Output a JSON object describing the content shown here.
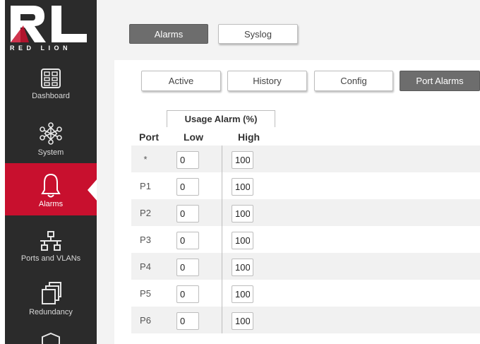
{
  "brand": {
    "logo_text": "RED LION",
    "colors": {
      "accent": "#c8102e",
      "sidebar": "#2b2b2b"
    }
  },
  "sidebar": {
    "items": [
      {
        "label": "Dashboard",
        "icon": "dashboard-icon",
        "active": false
      },
      {
        "label": "System",
        "icon": "system-icon",
        "active": false
      },
      {
        "label": "Alarms",
        "icon": "bell-icon",
        "active": true
      },
      {
        "label": "Ports and VLANs",
        "icon": "network-icon",
        "active": false
      },
      {
        "label": "Redundancy",
        "icon": "redundancy-icon",
        "active": false
      },
      {
        "label": "",
        "icon": "shield-icon",
        "active": false
      }
    ]
  },
  "top_tabs": [
    {
      "label": "Alarms",
      "selected": true
    },
    {
      "label": "Syslog",
      "selected": false
    }
  ],
  "sub_tabs": [
    {
      "label": "Active",
      "selected": false
    },
    {
      "label": "History",
      "selected": false
    },
    {
      "label": "Config",
      "selected": false
    },
    {
      "label": "Port Alarms",
      "selected": true
    }
  ],
  "table": {
    "group_header": "Usage Alarm (%)",
    "col_port": "Port",
    "col_low": "Low",
    "col_high": "High",
    "rows": [
      {
        "port": "*",
        "low": "0",
        "high": "100"
      },
      {
        "port": "P1",
        "low": "0",
        "high": "100"
      },
      {
        "port": "P2",
        "low": "0",
        "high": "100"
      },
      {
        "port": "P3",
        "low": "0",
        "high": "100"
      },
      {
        "port": "P4",
        "low": "0",
        "high": "100"
      },
      {
        "port": "P5",
        "low": "0",
        "high": "100"
      },
      {
        "port": "P6",
        "low": "0",
        "high": "100"
      }
    ]
  }
}
